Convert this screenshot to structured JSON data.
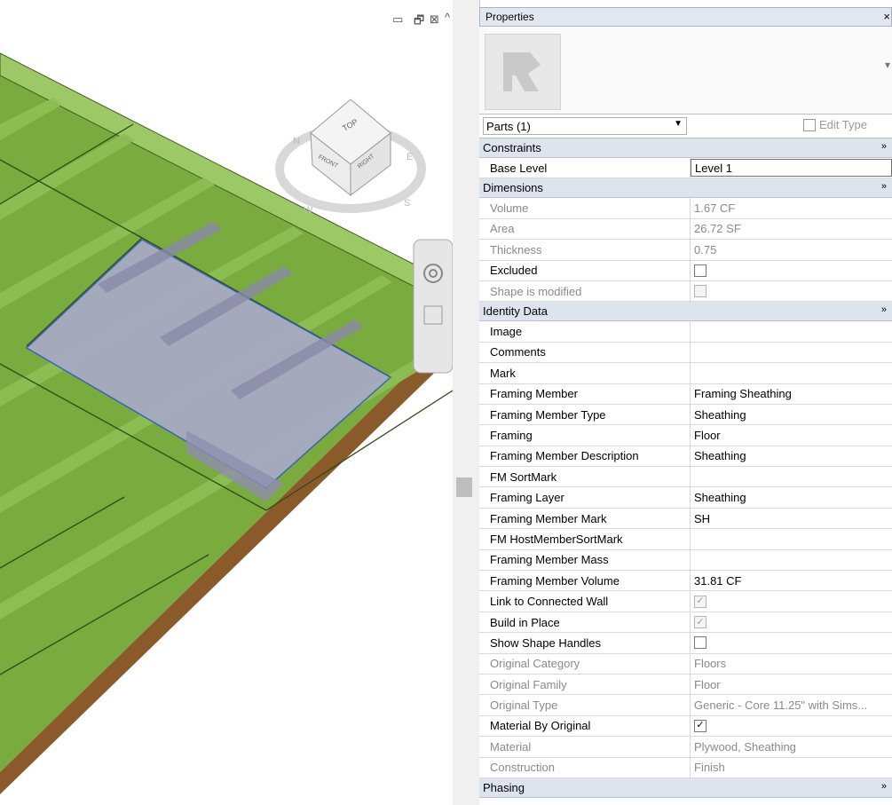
{
  "viewport": {
    "view_cube": {
      "top": "TOP",
      "front": "FRONT",
      "right": "RIGHT",
      "compass": [
        "N",
        "W",
        "S",
        "E"
      ]
    },
    "window_controls": {
      "minimize": "▭",
      "restore": "🗗",
      "close": "⊠",
      "collapse": "^"
    },
    "colors": {
      "floor_green": "#7aab3f",
      "joist_green": "#8fbf55",
      "edge_brown": "#8b5a2b",
      "selected_part": "#a9a9c9",
      "selection_outline": "#2e5fc0"
    }
  },
  "properties": {
    "title": "Properties",
    "close": "×",
    "more_icon": "▾",
    "type_selector": {
      "value": "Parts (1)",
      "edit_type": "Edit Type"
    },
    "groups": [
      {
        "name": "Constraints",
        "chevron": "»",
        "rows": [
          {
            "label": "Base Level",
            "value": "Level 1",
            "editable": true
          }
        ]
      },
      {
        "name": "Dimensions",
        "chevron": "»",
        "rows": [
          {
            "label": "Volume",
            "value": "1.67 CF",
            "readonly": true
          },
          {
            "label": "Area",
            "value": "26.72 SF",
            "readonly": true
          },
          {
            "label": "Thickness",
            "value": "0.75",
            "readonly": true
          },
          {
            "label": "Excluded",
            "checkbox": "unchecked"
          },
          {
            "label": "Shape is modified",
            "checkbox": "gray-unchecked",
            "readonly": true
          }
        ]
      },
      {
        "name": "Identity Data",
        "chevron": "»",
        "rows": [
          {
            "label": "Image",
            "value": ""
          },
          {
            "label": "Comments",
            "value": ""
          },
          {
            "label": "Mark",
            "value": ""
          },
          {
            "label": "Framing Member",
            "value": "Framing Sheathing"
          },
          {
            "label": "Framing Member Type",
            "value": "Sheathing"
          },
          {
            "label": "Framing",
            "value": "Floor"
          },
          {
            "label": "Framing Member Description",
            "value": "Sheathing"
          },
          {
            "label": "FM SortMark",
            "value": ""
          },
          {
            "label": "Framing Layer",
            "value": "Sheathing"
          },
          {
            "label": "Framing Member Mark",
            "value": "SH"
          },
          {
            "label": "FM HostMemberSortMark",
            "value": ""
          },
          {
            "label": "Framing Member Mass",
            "value": ""
          },
          {
            "label": "Framing Member Volume",
            "value": "31.81 CF"
          },
          {
            "label": "Link to Connected Wall",
            "checkbox": "gray-checked"
          },
          {
            "label": "Build in Place",
            "checkbox": "gray-checked"
          },
          {
            "label": "Show Shape Handles",
            "checkbox": "unchecked"
          },
          {
            "label": "Original Category",
            "value": "Floors",
            "readonly": true
          },
          {
            "label": "Original Family",
            "value": "Floor",
            "readonly": true
          },
          {
            "label": "Original Type",
            "value": "Generic - Core 11.25\" with Sims...",
            "readonly": true
          },
          {
            "label": "Material By Original",
            "checkbox": "checked"
          },
          {
            "label": "Material",
            "value": "Plywood, Sheathing",
            "readonly": true
          },
          {
            "label": "Construction",
            "value": "Finish",
            "readonly": true
          }
        ]
      },
      {
        "name": "Phasing",
        "chevron": "»",
        "rows": []
      }
    ]
  }
}
